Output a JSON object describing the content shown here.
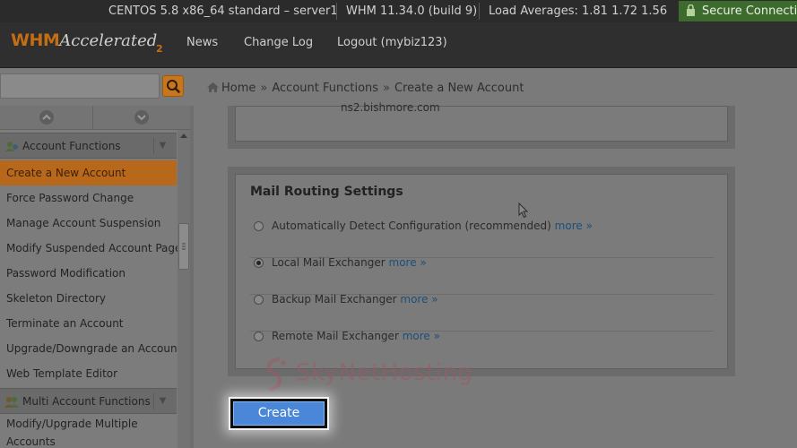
{
  "status_bar": {
    "os": "CENTOS 5.8 x86_64 standard – server1",
    "version": "WHM 11.34.0 (build 9)",
    "load": "Load Averages: 1.81 1.72 1.56",
    "secure": "Secure Connection"
  },
  "header": {
    "logo_whm": "WHM",
    "logo_accelerated": "Accelerated",
    "logo_version": "2",
    "nav": [
      "News",
      "Change Log",
      "Logout (mybiz123)"
    ]
  },
  "search": {
    "value": ""
  },
  "breadcrumb": {
    "items": [
      "Home",
      "Account Functions",
      "Create a New Account"
    ],
    "sep": "»"
  },
  "sidebar": {
    "section1": "Account Functions",
    "items": [
      "Create a New Account",
      "Force Password Change",
      "Manage Account Suspension",
      "Modify Suspended Account Page",
      "Password Modification",
      "Skeleton Directory",
      "Terminate an Account",
      "Upgrade/Downgrade an Account",
      "Web Template Editor"
    ],
    "section2": "Multi Account Functions",
    "items2": [
      "Modify/Upgrade Multiple",
      "Accounts"
    ]
  },
  "main": {
    "nameserver_text": "ns2.bishmore.com",
    "mail_routing": {
      "title": "Mail Routing Settings",
      "more": "more »",
      "options": [
        {
          "label": "Automatically Detect Configuration (recommended)",
          "checked": false
        },
        {
          "label": "Local Mail Exchanger",
          "checked": true
        },
        {
          "label": "Backup Mail Exchanger",
          "checked": false
        },
        {
          "label": "Remote Mail Exchanger",
          "checked": false
        }
      ]
    },
    "watermark": "SkyNetHosting",
    "create_label": "Create"
  },
  "colors": {
    "accent_orange": "#c8761c",
    "button_blue": "#4a87d9",
    "link_blue": "#1d4f79"
  }
}
